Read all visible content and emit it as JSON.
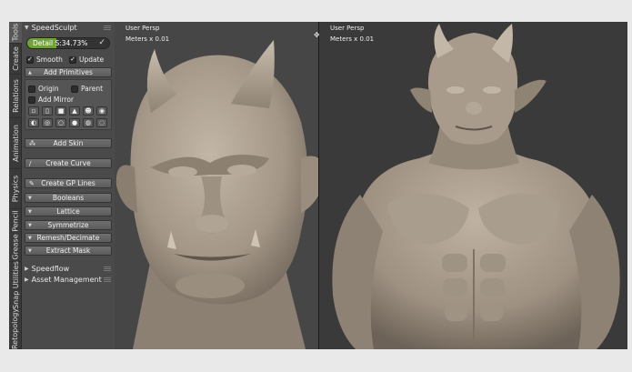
{
  "tabs": [
    "Tools",
    "Create",
    "Relations",
    "Animation",
    "Physics",
    "Grease Pencil",
    "Snap Utilities",
    "Retopology"
  ],
  "panel": {
    "title": "SpeedSculpt",
    "detail": {
      "label": "Detail S:34.73%",
      "fraction": 0.35
    },
    "smooth_label": "Smooth",
    "update_label": "Update",
    "add_primitives_label": "Add Primitives",
    "origin_label": "Origin",
    "parent_label": "Parent",
    "add_mirror_label": "Add Mirror",
    "primitive_icons": [
      "cube-icon",
      "cylinder-icon",
      "cube-filled-icon",
      "cone-icon",
      "monkey-icon",
      "eye-icon",
      "sphere-icon",
      "torus-icon",
      "ring-icon",
      "sphere-filled-icon",
      "torus-filled-icon",
      "ring-filled-icon"
    ],
    "add_skin_label": "Add Skin",
    "create_curve_label": "Create Curve",
    "create_gp_label": "Create GP Lines",
    "booleans_label": "Booleans",
    "lattice_label": "Lattice",
    "symmetrize_label": "Symmetrize",
    "remesh_label": "Remesh/Decimate",
    "extract_label": "Extract Mask",
    "speedflow_label": "Speedflow",
    "asset_label": "Asset Management"
  },
  "viewport_left": {
    "view": "User Persp",
    "units": "Meters x 0.01"
  },
  "viewport_right": {
    "view": "User Persp",
    "units": "Meters x 0.01"
  },
  "colors": {
    "accent": "#6fa33a",
    "clay": "#a79b8c"
  }
}
